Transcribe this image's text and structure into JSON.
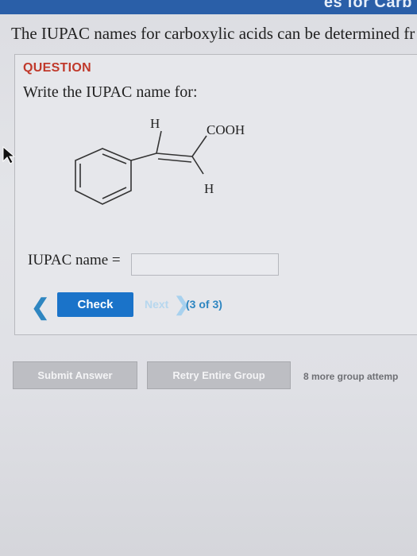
{
  "header": {
    "title_fragment": "es for Carb"
  },
  "intro_text": "The IUPAC names for carboxylic acids can be determined fr",
  "question": {
    "label": "QUESTION",
    "prompt": "Write the IUPAC name for:",
    "structure": {
      "atom_top_left": "H",
      "group_top_right": "COOH",
      "atom_bottom_right": "H"
    },
    "answer_label": "IUPAC name =",
    "answer_value": ""
  },
  "nav": {
    "prev_icon": "chevron-left-icon",
    "check_label": "Check",
    "next_label": "Next",
    "next_icon": "chevron-right-icon",
    "progress": "(3 of 3)"
  },
  "actions": {
    "submit_label": "Submit Answer",
    "retry_label": "Retry Entire Group",
    "attempts_text": "8 more group attemp"
  },
  "colors": {
    "accent_blue": "#1a73c9",
    "question_red": "#c0392b",
    "progress_blue": "#2e86c1"
  }
}
